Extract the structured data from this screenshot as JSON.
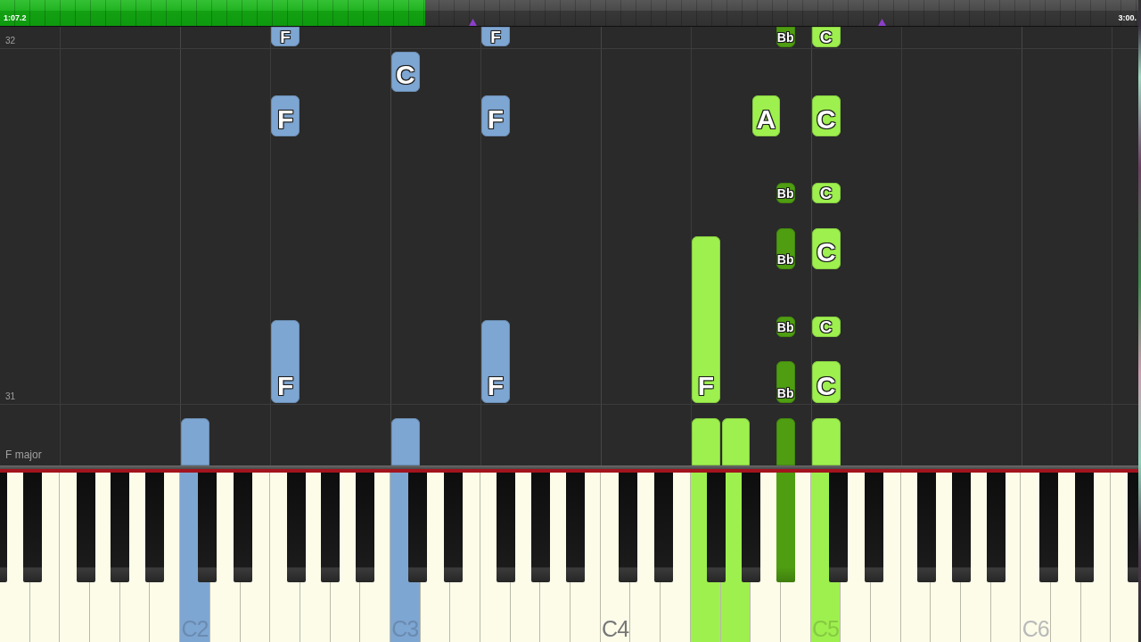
{
  "progress": {
    "elapsed": "1:07.2",
    "end_time": "3:00.",
    "level": 0.373
  },
  "roll": {
    "measures": [
      {
        "number": "32"
      },
      {
        "number": "31"
      }
    ],
    "key_signature": "F major"
  },
  "notes": [
    {
      "label": "F",
      "color": "#7ea6d2"
    },
    {
      "label": "F",
      "color": "#7ea6d2"
    },
    {
      "label": "Bb",
      "color": "#4f9e12"
    },
    {
      "label": "C",
      "color": "#9ef04e"
    },
    {
      "label": "C",
      "color": "#7ea6d2"
    },
    {
      "label": "F",
      "color": "#7ea6d2"
    },
    {
      "label": "F",
      "color": "#7ea6d2"
    },
    {
      "label": "A",
      "color": "#9ef04e"
    },
    {
      "label": "C",
      "color": "#9ef04e"
    },
    {
      "label": "Bb",
      "color": "#4f9e12"
    },
    {
      "label": "C",
      "color": "#9ef04e"
    },
    {
      "label": "Bb",
      "color": "#4f9e12"
    },
    {
      "label": "C",
      "color": "#9ef04e"
    },
    {
      "label": "F",
      "color": "#9ef04e"
    },
    {
      "label": "Bb",
      "color": "#4f9e12"
    },
    {
      "label": "C",
      "color": "#9ef04e"
    },
    {
      "label": "F",
      "color": "#7ea6d2"
    },
    {
      "label": "F",
      "color": "#7ea6d2"
    },
    {
      "label": "Bb",
      "color": "#4f9e12"
    },
    {
      "label": "C",
      "color": "#9ef04e"
    },
    {
      "color": "#7ea6d2"
    },
    {
      "color": "#7ea6d2"
    },
    {
      "color": "#9ef04e"
    },
    {
      "color": "#9ef04e"
    },
    {
      "color": "#4f9e12"
    },
    {
      "color": "#9ef04e"
    }
  ],
  "keyboard": {
    "white_keys": [
      {
        "pressed": false
      },
      {
        "pressed": false
      },
      {
        "pressed": false
      },
      {
        "pressed": false
      },
      {
        "pressed": false
      },
      {
        "pressed": false
      },
      {
        "pressed": true,
        "color": "#7ea6d2"
      },
      {
        "pressed": false
      },
      {
        "pressed": false
      },
      {
        "pressed": false
      },
      {
        "pressed": false
      },
      {
        "pressed": false
      },
      {
        "pressed": false
      },
      {
        "pressed": true,
        "color": "#7ea6d2"
      },
      {
        "pressed": false
      },
      {
        "pressed": false
      },
      {
        "pressed": false
      },
      {
        "pressed": false
      },
      {
        "pressed": false
      },
      {
        "pressed": false
      },
      {
        "pressed": false
      },
      {
        "pressed": false
      },
      {
        "pressed": false
      },
      {
        "pressed": true,
        "color": "#9ef04e"
      },
      {
        "pressed": true,
        "color": "#9ef04e"
      },
      {
        "pressed": false
      },
      {
        "pressed": false
      },
      {
        "pressed": true,
        "color": "#9ef04e"
      },
      {
        "pressed": false
      },
      {
        "pressed": false
      },
      {
        "pressed": false
      },
      {
        "pressed": false
      },
      {
        "pressed": false
      },
      {
        "pressed": false
      },
      {
        "pressed": false
      },
      {
        "pressed": false
      },
      {
        "pressed": false
      },
      {
        "pressed": false
      }
    ],
    "black_keys": [
      {
        "pressed": false
      },
      {
        "pressed": false
      },
      {
        "pressed": false
      },
      {
        "pressed": false
      },
      {
        "pressed": false
      },
      {
        "pressed": false
      },
      {
        "pressed": false
      },
      {
        "pressed": false
      },
      {
        "pressed": false
      },
      {
        "pressed": false
      },
      {
        "pressed": false
      },
      {
        "pressed": false
      },
      {
        "pressed": false
      },
      {
        "pressed": false
      },
      {
        "pressed": false
      },
      {
        "pressed": false
      },
      {
        "pressed": false
      },
      {
        "pressed": false
      },
      {
        "pressed": false
      },
      {
        "pressed": true,
        "color": "#4f9e12"
      },
      {
        "pressed": false
      },
      {
        "pressed": false
      },
      {
        "pressed": false
      },
      {
        "pressed": false
      },
      {
        "pressed": false
      },
      {
        "pressed": false
      },
      {
        "pressed": false
      },
      {
        "pressed": false
      }
    ],
    "octave_labels": [
      {
        "text": "C2",
        "emphasized": false
      },
      {
        "text": "C3",
        "emphasized": false
      },
      {
        "text": "C4",
        "emphasized": true
      },
      {
        "text": "C5",
        "emphasized": false
      },
      {
        "text": "C6",
        "emphasized": false
      }
    ]
  }
}
